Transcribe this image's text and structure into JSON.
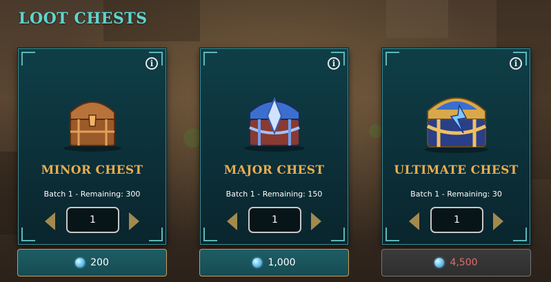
{
  "header": {
    "title": "LOOT CHESTS"
  },
  "chests": [
    {
      "name": "MINOR CHEST",
      "batch": "Batch 1 - Remaining: 300",
      "quantity": "1",
      "price": "200",
      "affordable": true,
      "color": "#b8733a"
    },
    {
      "name": "MAJOR CHEST",
      "batch": "Batch 1 - Remaining: 150",
      "quantity": "1",
      "price": "1,000",
      "affordable": true,
      "color": "#3a6fd0"
    },
    {
      "name": "ULTIMATE CHEST",
      "batch": "Batch 1 - Remaining: 30",
      "quantity": "1",
      "price": "4,500",
      "affordable": false,
      "color": "#d9a84a"
    }
  ],
  "icons": {
    "info": "info-icon",
    "currency": "gem-icon",
    "decrease": "chevron-left-icon",
    "increase": "chevron-right-icon"
  },
  "colors": {
    "title": "#5fd4d1",
    "chest_name": "#e9ad4f",
    "card_border": "#3f8d93",
    "button_border": "#c9a05a",
    "price_unaffordable": "#e36a6a"
  }
}
